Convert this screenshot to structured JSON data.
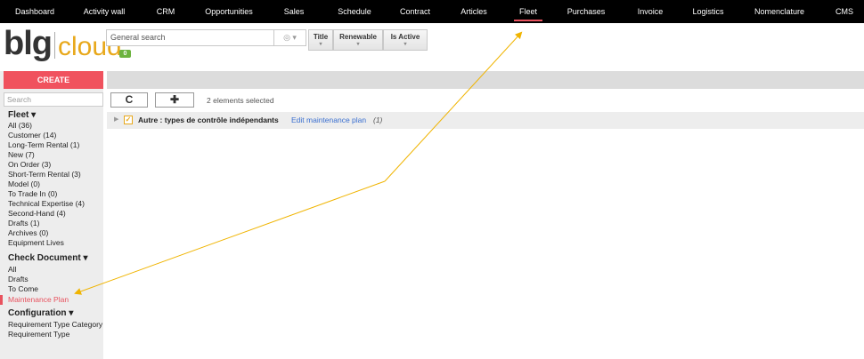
{
  "nav": {
    "items": [
      "Dashboard",
      "Activity wall",
      "CRM",
      "Opportunities",
      "Sales",
      "Schedule",
      "Contract",
      "Articles",
      "Fleet",
      "Purchases",
      "Invoice",
      "Logistics",
      "Nomenclature",
      "CMS"
    ],
    "active": "Fleet"
  },
  "logo": {
    "part1": "blg",
    "part2": "cloud"
  },
  "search": {
    "placeholder": "General search",
    "options_glyph": "◎ ▾",
    "badge": "0"
  },
  "filters": [
    {
      "label": "Title",
      "caret": "▾"
    },
    {
      "label": "Renewable",
      "caret": "▾"
    },
    {
      "label": "Is Active",
      "caret": "▾"
    }
  ],
  "sidebar": {
    "create_label": "CREATE",
    "search_placeholder": "Search",
    "sections": [
      {
        "title": "Fleet ▾",
        "items": [
          "All (36)",
          "Customer (14)",
          "Long-Term Rental (1)",
          "New (7)",
          "On Order (3)",
          "Short-Term Rental (3)",
          "Model (0)",
          "To Trade In (0)",
          "Technical Expertise (4)",
          "Second-Hand (4)",
          "Drafts (1)",
          "Archives (0)",
          "Equipment Lives"
        ]
      },
      {
        "title": "Check Document ▾",
        "items": [
          "All",
          "Drafts",
          "To Come",
          "Maintenance Plan"
        ]
      },
      {
        "title": "Configuration ▾",
        "items": [
          "Requirement Type Category",
          "Requirement Type"
        ]
      }
    ],
    "active_item": "Maintenance Plan"
  },
  "toolbar": {
    "refresh_glyph": "C",
    "add_glyph": "✚",
    "selection_text": "2 elements selected"
  },
  "rows": [
    {
      "expand_glyph": "▶",
      "check_glyph": "✓",
      "title": "Autre : types de contrôle indépendants",
      "link": "Edit maintenance plan",
      "count": "(1)"
    }
  ],
  "colors": {
    "accent": "#e8525e",
    "annotation": "#f0b400",
    "link": "#3a6fd0",
    "logo_cloud": "#e8a81b"
  }
}
